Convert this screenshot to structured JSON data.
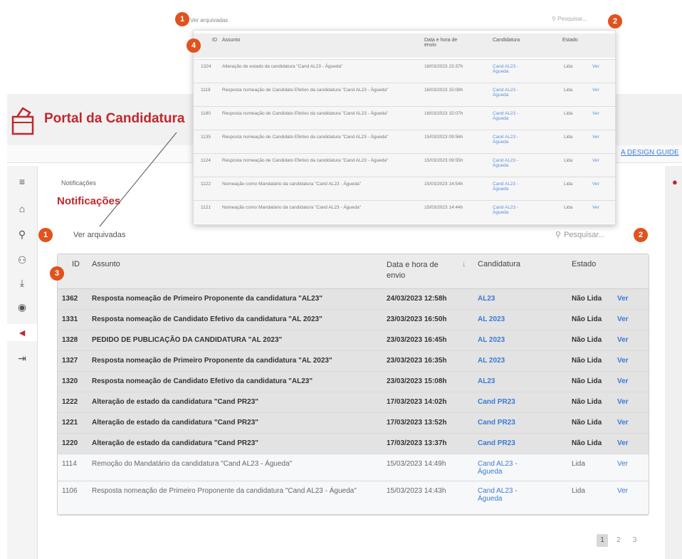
{
  "app": {
    "title": "Portal da Candidatura",
    "accessibility_link": "A DESIGN GUIDE"
  },
  "sidebar": {
    "items": [
      {
        "icon": "menu-icon",
        "glyph": "≡"
      },
      {
        "icon": "home-icon",
        "glyph": "⌂"
      },
      {
        "icon": "search-icon",
        "glyph": "⚲"
      },
      {
        "icon": "users-icon",
        "glyph": "👥"
      },
      {
        "icon": "download-icon",
        "glyph": "⤓"
      },
      {
        "icon": "view-icon",
        "glyph": "◉"
      },
      {
        "icon": "megaphone-icon",
        "glyph": "📢"
      },
      {
        "icon": "logout-icon",
        "glyph": "⇥"
      }
    ]
  },
  "main": {
    "breadcrumb": "Notificações",
    "page_title": "Notificações",
    "archive_link": "Ver arquivadas",
    "search_placeholder": "Pesquisar...",
    "columns": {
      "id": "ID",
      "subject": "Assunto",
      "date": "Data e hora de envio",
      "sort_indicator": "↓",
      "candidacy": "Candidatura",
      "state": "Estado"
    },
    "rows": [
      {
        "id": "1362",
        "subject": "Resposta nomeação de Primeiro Proponente da candidatura \"AL23\"",
        "date": "24/03/2023 12:58h",
        "candidacy": "AL23",
        "state": "Não Lida",
        "action": "Ver",
        "read": false
      },
      {
        "id": "1331",
        "subject": "Resposta nomeação de Candidato Efetivo da candidatura \"AL 2023\"",
        "date": "23/03/2023 16:50h",
        "candidacy": "AL 2023",
        "state": "Não Lida",
        "action": "Ver",
        "read": false
      },
      {
        "id": "1328",
        "subject": "PEDIDO DE PUBLICAÇÃO DA CANDIDATURA \"AL 2023\"",
        "date": "23/03/2023 16:45h",
        "candidacy": "AL 2023",
        "state": "Não Lida",
        "action": "Ver",
        "read": false
      },
      {
        "id": "1327",
        "subject": "Resposta nomeação de Primeiro Proponente da candidatura \"AL 2023\"",
        "date": "23/03/2023 16:35h",
        "candidacy": "AL 2023",
        "state": "Não Lida",
        "action": "Ver",
        "read": false
      },
      {
        "id": "1320",
        "subject": "Resposta nomeação de Candidato Efetivo da candidatura \"AL23\"",
        "date": "23/03/2023 15:08h",
        "candidacy": "AL23",
        "state": "Não Lida",
        "action": "Ver",
        "read": false
      },
      {
        "id": "1222",
        "subject": "Alteração de estado da candidatura \"Cand PR23\"",
        "date": "17/03/2023 14:02h",
        "candidacy": "Cand PR23",
        "state": "Não Lida",
        "action": "Ver",
        "read": false
      },
      {
        "id": "1221",
        "subject": "Alteração de estado da candidatura \"Cand PR23\"",
        "date": "17/03/2023 13:52h",
        "candidacy": "Cand PR23",
        "state": "Não Lida",
        "action": "Ver",
        "read": false
      },
      {
        "id": "1220",
        "subject": "Alteração de estado da candidatura \"Cand PR23\"",
        "date": "17/03/2023 13:37h",
        "candidacy": "Cand PR23",
        "state": "Não Lida",
        "action": "Ver",
        "read": false
      },
      {
        "id": "1114",
        "subject": "Remoção do Mandatário da candidatura \"Cand AL23 - Águeda\"",
        "date": "15/03/2023 14:49h",
        "candidacy": "Cand AL23 - Águeda",
        "state": "Lida",
        "action": "Ver",
        "read": true
      },
      {
        "id": "1106",
        "subject": "Resposta nomeação de Primeiro Proponente da candidatura \"Cand AL23 - Águeda\"",
        "date": "15/03/2023 14:43h",
        "candidacy": "Cand AL23 - Águeda",
        "state": "Lida",
        "action": "Ver",
        "read": true
      }
    ],
    "pagination": {
      "pages": [
        "1",
        "2",
        "3"
      ],
      "current": "1"
    }
  },
  "zoom": {
    "archive_link": "Ver arquivadas",
    "search_placeholder": "Pesquisar...",
    "columns": {
      "id": "ID",
      "subject": "Assunto",
      "date": "Data e hora de envio",
      "candidacy": "Candidatura",
      "state": "Estado"
    },
    "rows": [
      {
        "id": "1324",
        "subject": "Alteração de estado da candidatura \"Cand AL23 - Águeda\"",
        "date": "18/03/2023 23:37h",
        "candidacy": "Cand AL23 - Águeda",
        "state": "Lida",
        "action": "Ver"
      },
      {
        "id": "1119",
        "subject": "Resposta nomeação de Candidato Efetivo da candidatura \"Cand AL23 - Águeda\"",
        "date": "16/03/2023 15:08h",
        "candidacy": "Cand AL23 - Águeda",
        "state": "Lida",
        "action": "Ver"
      },
      {
        "id": "1180",
        "subject": "Resposta nomeação de Candidato Efetivo da candidatura \"Cand AL23 - Águeda\"",
        "date": "16/03/2023 15:07h",
        "candidacy": "Cand AL23 - Águeda",
        "state": "Lida",
        "action": "Ver"
      },
      {
        "id": "1135",
        "subject": "Resposta nomeação de Candidato Efetivo da candidatura \"Cand AL23 - Águeda\"",
        "date": "15/03/2023 09:56h",
        "candidacy": "Cand AL23 - Águeda",
        "state": "Lida",
        "action": "Ver"
      },
      {
        "id": "1124",
        "subject": "Resposta nomeação de Candidato Efetivo da candidatura \"Cand AL23 - Águeda\"",
        "date": "15/03/2023 09:55h",
        "candidacy": "Cand AL23 - Águeda",
        "state": "Lida",
        "action": "Ver"
      },
      {
        "id": "1122",
        "subject": "Nomeação como Mandatário da candidatura \"Cand AL23 - Águeda\"",
        "date": "15/03/2023 14:54h",
        "candidacy": "Cand AL23 - Águeda",
        "state": "Lida",
        "action": "Ver"
      },
      {
        "id": "1121",
        "subject": "Nomeação como Mandatário da candidatura \"Cand AL23 - Águeda\"",
        "date": "15/03/2023 14:44h",
        "candidacy": "Cand AL23 - Águeda",
        "state": "Lida",
        "action": "Ver"
      }
    ]
  },
  "badges": [
    "1",
    "2",
    "3",
    "4"
  ],
  "colors": {
    "brand": "#c0272d",
    "badge": "#e0521e",
    "link": "#3a7bd5"
  }
}
